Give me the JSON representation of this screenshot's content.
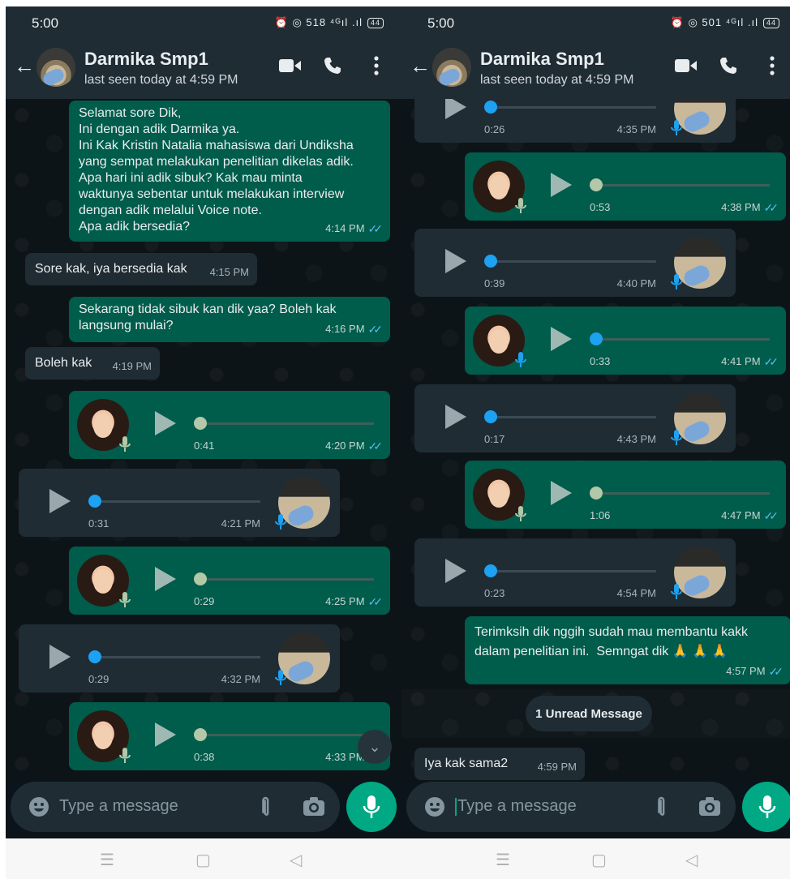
{
  "status_bar": {
    "left_time": "5:00",
    "left_icons": "⏰ ◎ 518 ⁴ᴳıl .ıl",
    "left_battery": "44",
    "right_time": "5:00",
    "right_icons": "⏰ ◎ 501 ⁴ᴳıl .ıl",
    "right_battery": "44"
  },
  "contact": {
    "name": "Darmika Smp1",
    "status": "last seen today at 4:59 PM"
  },
  "left_messages": [
    {
      "text": "Selamat sore Dik,\nIni dengan adik Darmika ya.\nIni Kak Kristin Natalia mahasiswa dari Undiksha\nyang sempat melakukan penelitian dikelas adik.\nApa hari ini adik sibuk? Kak mau minta\nwaktunya sebentar untuk melakukan interview\ndengan adik melalui Voice note.\nApa adik bersedia?",
      "time": "4:14 PM"
    },
    {
      "text": "Sore kak, iya bersedia kak",
      "time": "4:15 PM"
    },
    {
      "text": "Sekarang tidak sibuk kan dik yaa? Boleh kak\nlangsung mulai?",
      "time": "4:16 PM"
    },
    {
      "text": "Boleh kak",
      "time": "4:19 PM"
    }
  ],
  "left_voice": [
    {
      "dir": "out",
      "duration": "0:41",
      "time": "4:20 PM"
    },
    {
      "dir": "in",
      "duration": "0:31",
      "time": "4:21 PM"
    },
    {
      "dir": "out",
      "duration": "0:29",
      "time": "4:25 PM"
    },
    {
      "dir": "in",
      "duration": "0:29",
      "time": "4:32 PM"
    },
    {
      "dir": "out",
      "duration": "0:38",
      "time": "4:33 PM"
    }
  ],
  "right_voice": [
    {
      "dir": "in",
      "duration": "0:26",
      "time": "4:35 PM"
    },
    {
      "dir": "out",
      "duration": "0:53",
      "time": "4:38 PM"
    },
    {
      "dir": "in",
      "duration": "0:39",
      "time": "4:40 PM"
    },
    {
      "dir": "out",
      "duration": "0:33",
      "time": "4:41 PM"
    },
    {
      "dir": "in",
      "duration": "0:17",
      "time": "4:43 PM"
    },
    {
      "dir": "out",
      "duration": "1:06",
      "time": "4:47 PM"
    },
    {
      "dir": "in",
      "duration": "0:23",
      "time": "4:54 PM"
    }
  ],
  "right_messages": [
    {
      "text": "Terimksih dik nggih sudah mau membantu kakk\ndalam penelitian ini.  Semngat dik 🙏 🙏 🙏",
      "time": "4:57 PM"
    },
    {
      "text": "Iya kak sama2",
      "time": "4:59 PM"
    }
  ],
  "unread_label": "1 Unread Message",
  "input": {
    "placeholder": "Type a message"
  },
  "nav": {
    "menu": "☰",
    "home": "▢",
    "back": "◁"
  },
  "colors": {
    "outgoing": "#005c4b",
    "incoming": "#1f2c34",
    "accent": "#00a884",
    "ticks": "#53bdeb"
  }
}
